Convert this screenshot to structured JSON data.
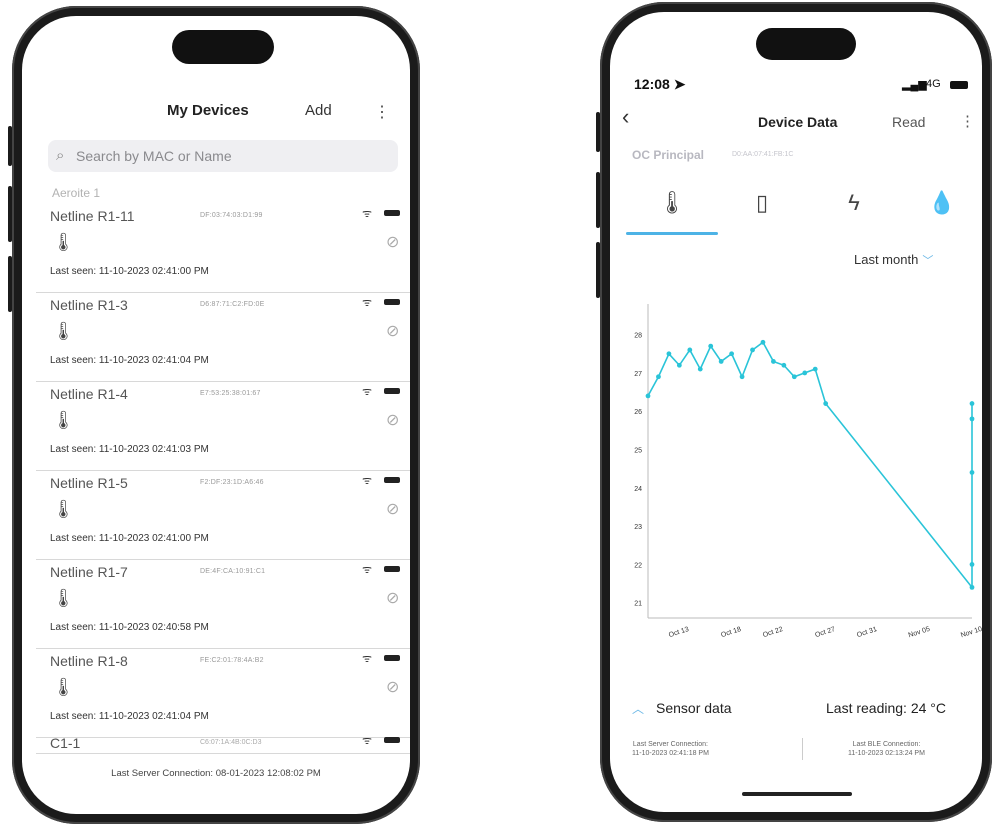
{
  "left_screen": {
    "title": "My Devices",
    "add_label": "Add",
    "menu_glyph": "⋮",
    "search": {
      "icon": "search-icon",
      "placeholder": "Search by MAC or Name"
    },
    "ghost_row_name": "Aeroite 1",
    "devices": [
      {
        "name": "Netline R1-11",
        "mac": "DF:03:74:03:D1:99",
        "last_seen": "Last seen: 11-10-2023 02:41:00 PM"
      },
      {
        "name": "Netline R1-3",
        "mac": "D6:87:71:C2:FD:0E",
        "last_seen": "Last seen: 11-10-2023 02:41:04 PM"
      },
      {
        "name": "Netline R1-4",
        "mac": "E7:53:25:38:01:67",
        "last_seen": "Last seen: 11-10-2023 02:41:03 PM"
      },
      {
        "name": "Netline R1-5",
        "mac": "F2:DF:23:1D:A6:46",
        "last_seen": "Last seen: 11-10-2023 02:41:00 PM"
      },
      {
        "name": "Netline R1-7",
        "mac": "DE:4F:CA:10:91:C1",
        "last_seen": "Last seen: 11-10-2023 02:40:58 PM"
      },
      {
        "name": "Netline R1-8",
        "mac": "FE:C2:01:78:4A:B2",
        "last_seen": "Last seen: 11-10-2023 02:41:04 PM"
      }
    ],
    "partial_device": {
      "name": "C1-1",
      "mac": "C6:07:1A:4B:0C:D3"
    },
    "footer": "Last Server Connection: 08-01-2023 12:08:02 PM"
  },
  "right_screen": {
    "status_time": "12:08 ➤",
    "status_network": "4G",
    "back_glyph": "‹",
    "title": "Device Data",
    "read_label": "Read",
    "menu_glyph": "⋮",
    "device_name": "OC Principal",
    "device_mac": "D0:AA:07:41:FB:1C",
    "tabs": [
      {
        "icon": "thermometer-icon",
        "glyph": "🌡"
      },
      {
        "icon": "vibration-icon",
        "glyph": "▯"
      },
      {
        "icon": "lightning-icon",
        "glyph": "ϟ"
      },
      {
        "icon": "humidity-icon",
        "glyph": "💧"
      }
    ],
    "range_label": "Last month",
    "sensor_label": "Sensor data",
    "last_reading": "Last reading: 24 °C",
    "last_server_connection_label": "Last Server Connection:",
    "last_server_connection_value": "11-10-2023 02:41:18 PM",
    "last_ble_connection_label": "Last BLE Connection:",
    "last_ble_connection_value": "11-10-2023 02:13:24 PM"
  },
  "chart_data": {
    "type": "line",
    "title": "",
    "xlabel": "",
    "ylabel": "",
    "x_ticks": [
      "Oct 13",
      "Oct 18",
      "Oct 22",
      "Oct 27",
      "Oct 31",
      "Nov 05",
      "Nov 10"
    ],
    "y_ticks": [
      21,
      22,
      23,
      24,
      25,
      26,
      27,
      28
    ],
    "ylim": [
      20.6,
      28.8
    ],
    "series_color": "#2ac4d8",
    "series": [
      {
        "points": [
          [
            "Oct 10",
            26.4
          ],
          [
            "Oct 11",
            26.9
          ],
          [
            "Oct 12",
            27.5
          ],
          [
            "Oct 13",
            27.2
          ],
          [
            "Oct 14",
            27.6
          ],
          [
            "Oct 15",
            27.1
          ],
          [
            "Oct 16",
            27.7
          ],
          [
            "Oct 17",
            27.3
          ],
          [
            "Oct 18",
            27.5
          ],
          [
            "Oct 19",
            26.9
          ],
          [
            "Oct 20",
            27.6
          ],
          [
            "Oct 21",
            27.8
          ],
          [
            "Oct 22",
            27.3
          ],
          [
            "Oct 23",
            27.2
          ],
          [
            "Oct 24",
            26.9
          ],
          [
            "Oct 25",
            27.0
          ],
          [
            "Oct 26",
            27.1
          ],
          [
            "Oct 27",
            26.2
          ],
          [
            "Nov 10",
            21.4
          ],
          [
            "Nov 10",
            22.0
          ],
          [
            "Nov 10",
            24.4
          ],
          [
            "Nov 10",
            25.8
          ],
          [
            "Nov 10",
            26.2
          ]
        ]
      }
    ]
  }
}
